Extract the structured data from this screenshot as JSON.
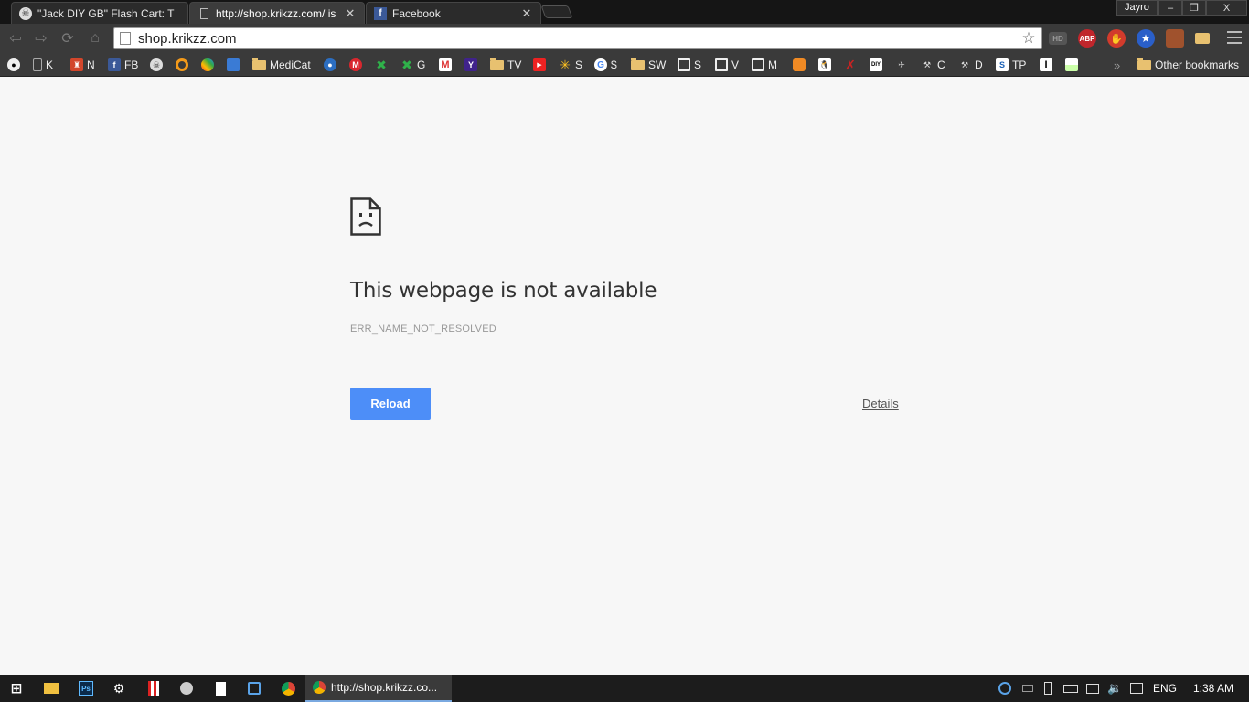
{
  "tabs": [
    {
      "title": "\"Jack DIY GB\" Flash Cart: T",
      "icon": "jack-icon"
    },
    {
      "title": "http://shop.krikzz.com/ is",
      "icon": "page-icon"
    },
    {
      "title": "Facebook",
      "icon": "facebook-icon"
    }
  ],
  "profile_name": "Jayro",
  "window_controls": {
    "minimize": "–",
    "restore": "❐",
    "close": "X"
  },
  "omnibox": {
    "url": "shop.krikzz.com"
  },
  "extensions": [
    "hd-icon",
    "adblock-plus-icon",
    "stop-hand-icon",
    "star-badge-icon",
    "cookie-icon",
    "folder-ext-icon"
  ],
  "extension_labels": {
    "adblock": "ABP",
    "hd": "HD"
  },
  "bookmarks": [
    {
      "label": "",
      "icon": "panda-icon"
    },
    {
      "label": "K",
      "icon": "page-icon"
    },
    {
      "label": "N",
      "icon": "mario-icon"
    },
    {
      "label": "FB",
      "icon": "facebook-icon"
    },
    {
      "label": "",
      "icon": "jack-icon"
    },
    {
      "label": "",
      "icon": "orange-ring-icon"
    },
    {
      "label": "",
      "icon": "colorful-icon"
    },
    {
      "label": "",
      "icon": "blocks-icon"
    },
    {
      "label": "MediCat",
      "icon": "folder-icon"
    },
    {
      "label": "",
      "icon": "blue-eye-icon"
    },
    {
      "label": "",
      "icon": "mega-icon"
    },
    {
      "label": "",
      "icon": "green-x-icon"
    },
    {
      "label": "G",
      "icon": "green-x-icon"
    },
    {
      "label": "",
      "icon": "gmail-icon"
    },
    {
      "label": "",
      "icon": "yahoo-icon"
    },
    {
      "label": "TV",
      "icon": "folder-icon"
    },
    {
      "label": "",
      "icon": "youtube-icon"
    },
    {
      "label": "S",
      "icon": "walmart-icon"
    },
    {
      "label": "$",
      "icon": "google-icon"
    },
    {
      "label": "SW",
      "icon": "folder-icon"
    },
    {
      "label": "S",
      "icon": "monitor-icon"
    },
    {
      "label": "V",
      "icon": "monitor-icon"
    },
    {
      "label": "M",
      "icon": "monitor-icon"
    },
    {
      "label": "",
      "icon": "lion-icon"
    },
    {
      "label": "",
      "icon": "penguin-icon"
    },
    {
      "label": "",
      "icon": "x-logo-icon"
    },
    {
      "label": "",
      "icon": "diy-icon"
    },
    {
      "label": "",
      "icon": "bird-icon"
    },
    {
      "label": "C",
      "icon": "tools-icon"
    },
    {
      "label": "D",
      "icon": "tools-icon"
    },
    {
      "label": "TP",
      "icon": "sp-icon"
    },
    {
      "label": "",
      "icon": "letter-t-icon"
    },
    {
      "label": "",
      "icon": "image-icon"
    }
  ],
  "bookmark_icon_text": {
    "fb": "f",
    "mega": "M",
    "yahoo": "Y",
    "diy": "DIY",
    "sp": "S",
    "lt": "I"
  },
  "overflow_chevron": "»",
  "other_bookmarks": "Other bookmarks",
  "error": {
    "title": "This webpage is not available",
    "code": "ERR_NAME_NOT_RESOLVED",
    "reload_label": "Reload",
    "details_label": "Details"
  },
  "taskbar": {
    "active_window": "http://shop.krikzz.co...",
    "ps_label": "Ps",
    "language": "ENG",
    "time": "1:38 AM"
  },
  "colors": {
    "reload_button": "#4d8ef8",
    "page_background": "#f7f7f7",
    "chrome_frame": "#3a3a3a"
  }
}
